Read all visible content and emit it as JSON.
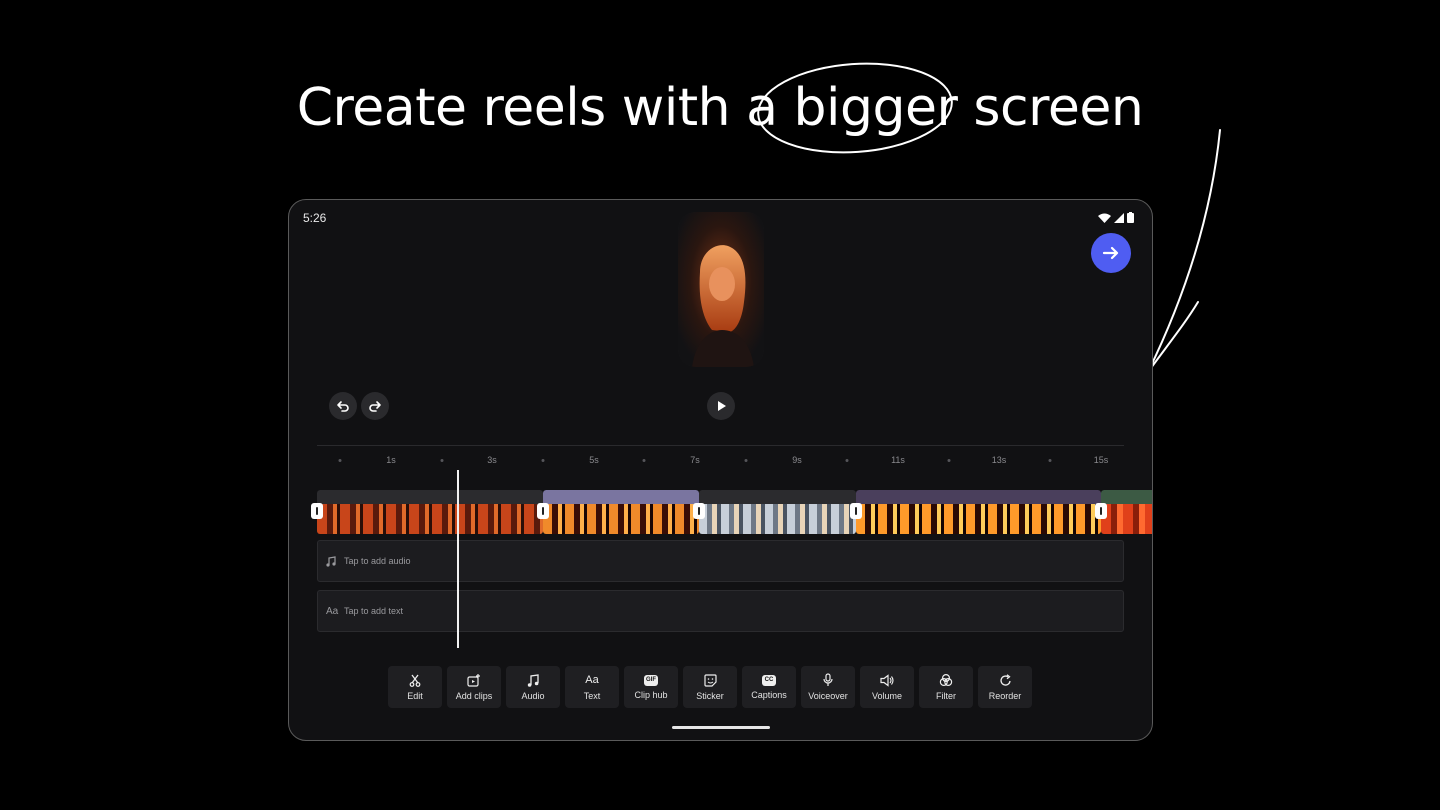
{
  "headline": "Create reels with a bigger screen",
  "status": {
    "time": "5:26"
  },
  "ruler": {
    "labels": [
      "1s",
      "3s",
      "5s",
      "7s",
      "9s",
      "11s",
      "13s",
      "15s"
    ]
  },
  "tracks": {
    "audio_label": "Tap to add audio",
    "text_label": "Tap to add text",
    "text_icon": "Aa"
  },
  "toolbar": [
    {
      "label": "Edit",
      "icon": "scissors-icon"
    },
    {
      "label": "Add clips",
      "icon": "add-clip-icon"
    },
    {
      "label": "Audio",
      "icon": "music-note-icon"
    },
    {
      "label": "Text",
      "icon": "Aa"
    },
    {
      "label": "Clip hub",
      "icon": "GIF"
    },
    {
      "label": "Sticker",
      "icon": "sticker-icon"
    },
    {
      "label": "Captions",
      "icon": "CC"
    },
    {
      "label": "Voiceover",
      "icon": "microphone-icon"
    },
    {
      "label": "Volume",
      "icon": "speaker-icon"
    },
    {
      "label": "Filter",
      "icon": "filter-icon"
    },
    {
      "label": "Reorder",
      "icon": "reorder-icon"
    }
  ],
  "colors": {
    "accent": "#4f5df2",
    "background": "#000000",
    "panel": "#111113"
  }
}
